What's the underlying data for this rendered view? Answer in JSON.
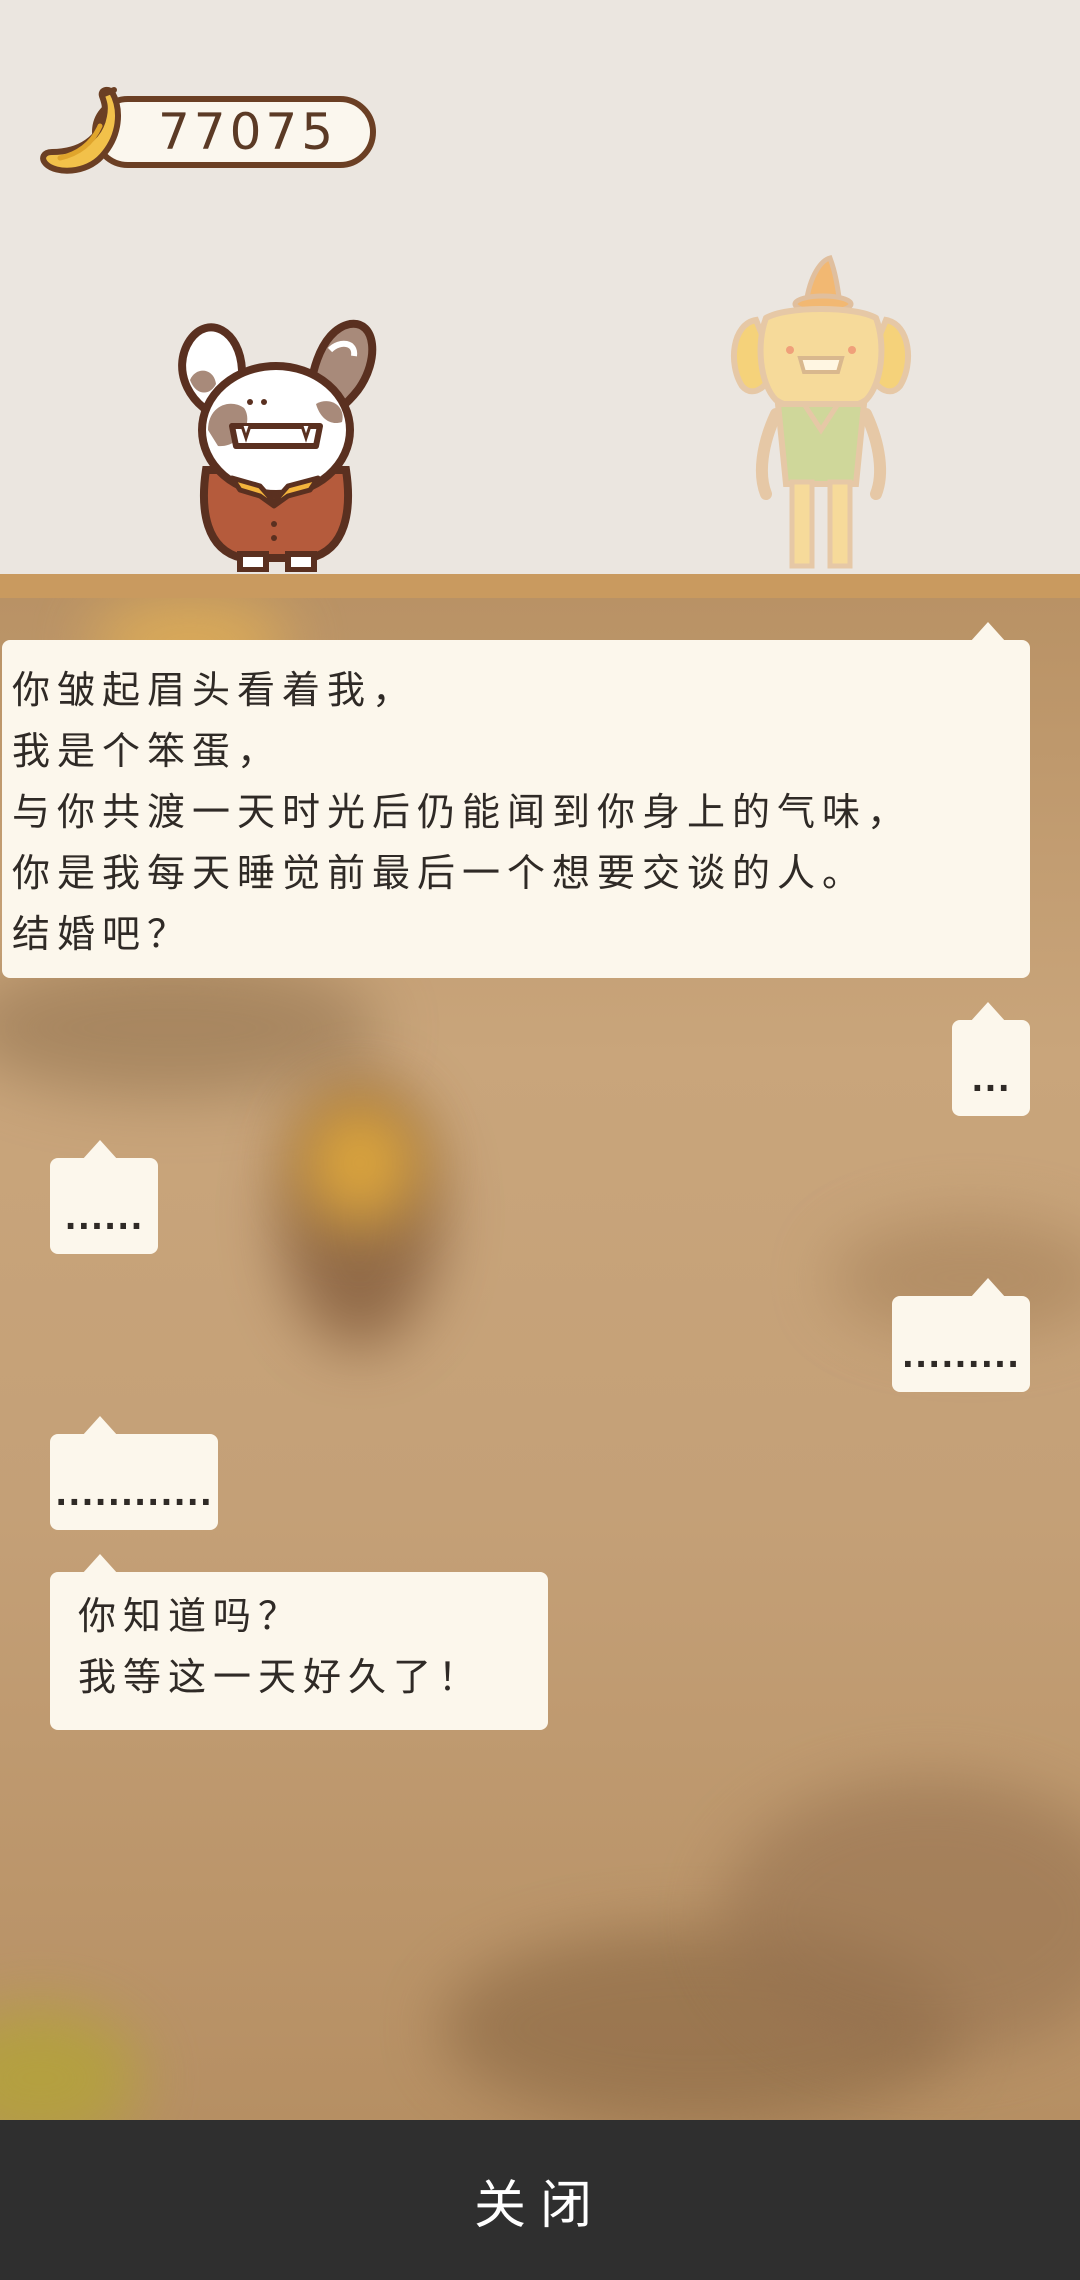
{
  "hud": {
    "banana_count": "77075",
    "banana_icon": "banana-icon"
  },
  "scene": {
    "characters": [
      "rabbit-character",
      "dog-character"
    ]
  },
  "chat": {
    "message_1": {
      "side": "left",
      "lines": [
        "你皱起眉头看着我，",
        "我是个笨蛋，",
        "与你共渡一天时光后仍能闻到你身上的气味，",
        "你是我每天睡觉前最后一个想要交谈的人。",
        "结婚吧？"
      ]
    },
    "message_2": {
      "side": "right",
      "text": "..."
    },
    "message_3": {
      "side": "left",
      "text": "......"
    },
    "message_4": {
      "side": "right",
      "text": "........."
    },
    "message_5": {
      "side": "left",
      "text": "............"
    },
    "message_6": {
      "side": "left",
      "lines": [
        "你知道吗？",
        "我等这一天好久了！"
      ]
    }
  },
  "bottom_bar": {
    "close_label": "关闭"
  },
  "colors": {
    "scene_bg": "#ebe6e0",
    "floor": "#c99a5f",
    "bubble_bg": "#fcf7ec",
    "bottom_bar": "#2f2f2f",
    "text_dark": "#2f2a26",
    "currency_border": "#6b3f24"
  }
}
